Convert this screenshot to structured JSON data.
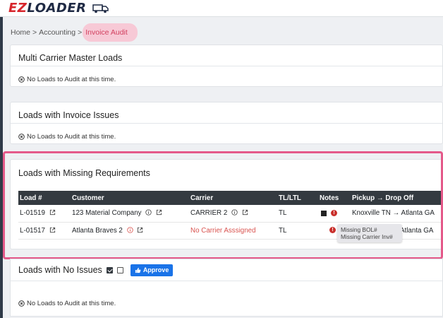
{
  "brand": {
    "logo_ez": "EZ",
    "logo_rest": "LOADER"
  },
  "breadcrumb": {
    "home": "Home",
    "sep1": ">",
    "accounting": "Accounting",
    "sep2": ">",
    "current": "Invoice Audit"
  },
  "sections": {
    "multi_carrier": {
      "title": "Multi Carrier Master Loads",
      "empty": "No Loads to Audit at this time."
    },
    "invoice_issues": {
      "title": "Loads with Invoice Issues",
      "empty": "No Loads to Audit at this time."
    },
    "missing_requirements": {
      "title": "Loads with Missing Requirements",
      "columns": {
        "load": "Load #",
        "customer": "Customer",
        "carrier": "Carrier",
        "tl": "TL/LTL",
        "notes": "Notes",
        "pickup": "Pickup",
        "dropoff": "Drop Off"
      },
      "rows": [
        {
          "load": "L-01519",
          "customer": "123 Material Company",
          "carrier": "CARRIER 2",
          "tl": "TL",
          "pickup": "Knoxville TN",
          "dropoff": "Atlanta GA"
        },
        {
          "load": "L-01517",
          "customer": "Atlanta Braves 2",
          "carrier": "No Carrier Asssigned",
          "tl": "TL",
          "pickup": "",
          "dropoff": "Atlanta GA"
        }
      ],
      "tooltip": {
        "line1": "Missing BOL#",
        "line2": "Missing Carrier Inv#"
      }
    },
    "no_issues": {
      "title": "Loads with No Issues",
      "approve_label": "Approve",
      "empty": "No Loads to Audit at this time."
    }
  },
  "colors": {
    "accent_pink": "#e4598a",
    "dark_header": "#343a40",
    "error_red": "#c9302c",
    "approve_blue": "#1a73e8"
  }
}
